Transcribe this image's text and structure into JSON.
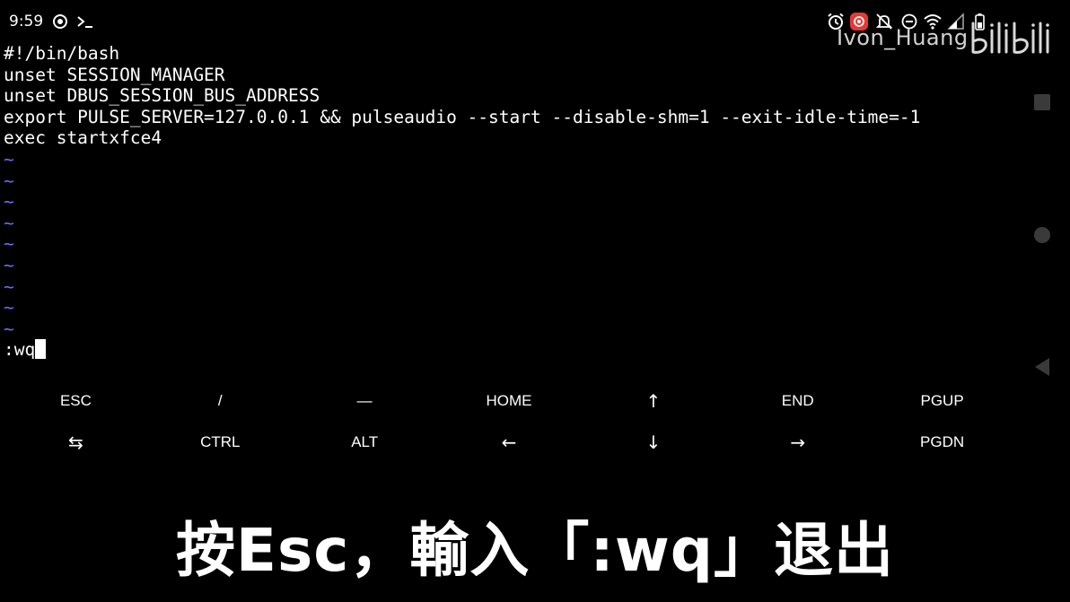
{
  "status_bar": {
    "time": "9:59",
    "left_icons": [
      "record-icon",
      "terminal-icon"
    ],
    "right_icons": [
      "alarm-icon",
      "screen-record-icon",
      "mute-icon",
      "dnd-icon",
      "wifi-icon",
      "signal-icon",
      "battery-icon"
    ],
    "accent_record_color": "#e53935"
  },
  "watermark": {
    "user": "Ivon_Huang",
    "logo": "bilibili"
  },
  "terminal": {
    "lines": [
      "#!/bin/bash",
      "unset SESSION_MANAGER",
      "unset DBUS_SESSION_BUS_ADDRESS",
      "export PULSE_SERVER=127.0.0.1 && pulseaudio --start --disable-shm=1 --exit-idle-time=-1",
      "exec startxfce4"
    ],
    "tildes": [
      "~",
      "~",
      "~",
      "~",
      "~",
      "~",
      "~",
      "~",
      "~"
    ],
    "command_line": ":wq",
    "tilde_color": "#6b6bff"
  },
  "extra_keys": {
    "row1": [
      "ESC",
      "/",
      "—",
      "HOME",
      "↑",
      "END",
      "PGUP"
    ],
    "row2": [
      "⇆",
      "CTRL",
      "ALT",
      "←",
      "↓",
      "→",
      "PGDN"
    ]
  },
  "nav_buttons": [
    "recents-square-icon",
    "home-circle-icon",
    "back-triangle-icon"
  ],
  "subtitle": "按Esc，輸入「:wq」退出"
}
